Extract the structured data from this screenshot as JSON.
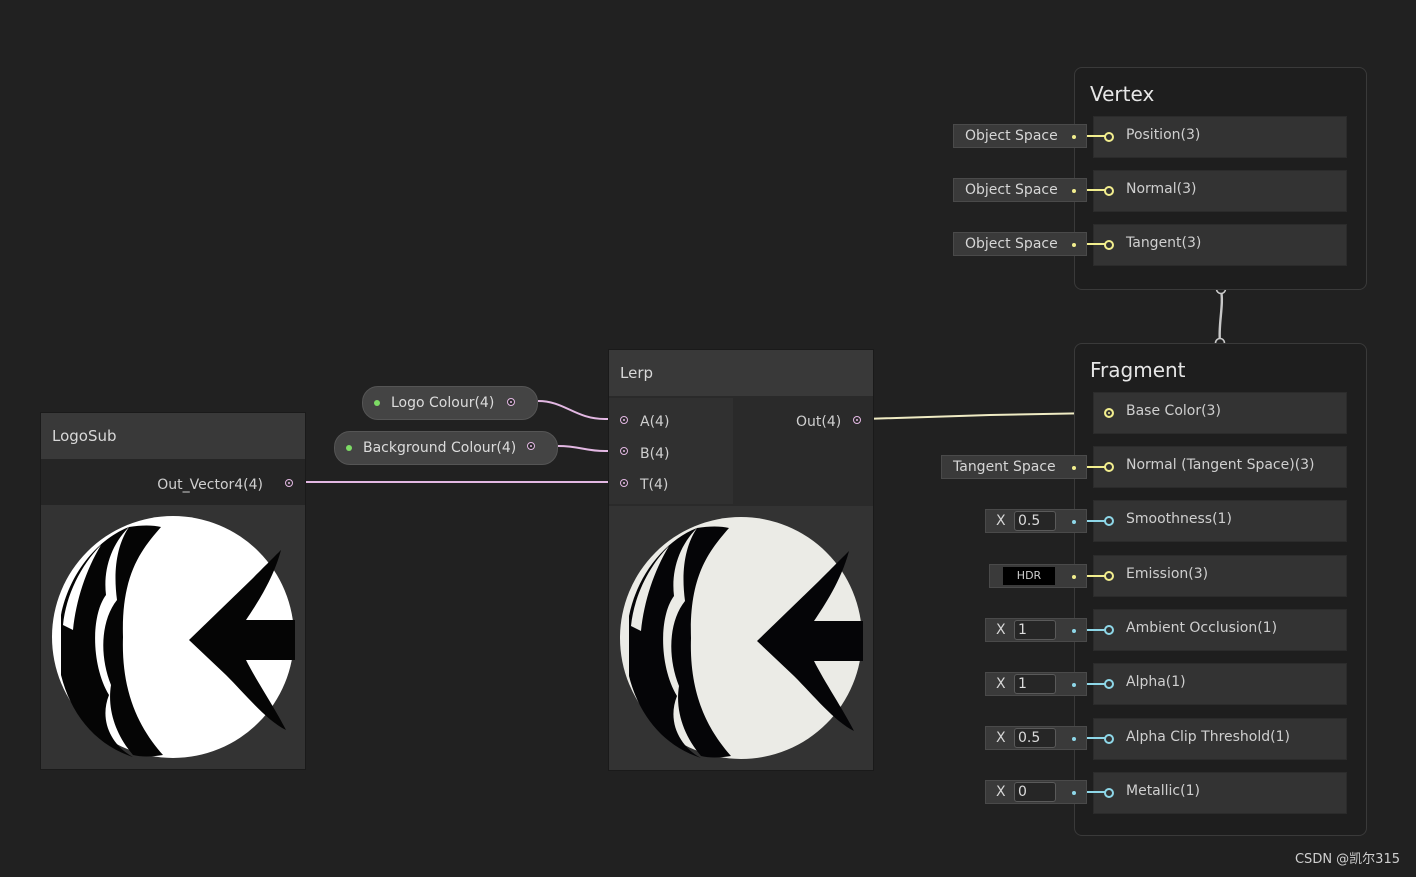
{
  "colors": {
    "background": "#212121",
    "float_port": "#e3b8e3",
    "vector3_port": "#f2ee8e",
    "vector1_port": "#8ed7e8",
    "property_dot": "#7ddc65"
  },
  "properties": [
    {
      "label": "Logo Colour(4)"
    },
    {
      "label": "Background Colour(4)"
    }
  ],
  "logosub": {
    "title": "LogoSub",
    "output": "Out_Vector4(4)"
  },
  "lerp": {
    "title": "Lerp",
    "inputs": [
      "A(4)",
      "B(4)",
      "T(4)"
    ],
    "output": "Out(4)"
  },
  "vertex": {
    "title": "Vertex",
    "blocks": [
      {
        "label": "Position(3)",
        "widget": "Object Space"
      },
      {
        "label": "Normal(3)",
        "widget": "Object Space"
      },
      {
        "label": "Tangent(3)",
        "widget": "Object Space"
      }
    ]
  },
  "fragment": {
    "title": "Fragment",
    "blocks": [
      {
        "label": "Base Color(3)"
      },
      {
        "label": "Normal (Tangent Space)(3)",
        "widget": "Tangent Space"
      },
      {
        "label": "Smoothness(1)",
        "axis": "X",
        "value": "0.5"
      },
      {
        "label": "Emission(3)",
        "widget": "HDR"
      },
      {
        "label": "Ambient Occlusion(1)",
        "axis": "X",
        "value": "1"
      },
      {
        "label": "Alpha(1)",
        "axis": "X",
        "value": "1"
      },
      {
        "label": "Alpha Clip Threshold(1)",
        "axis": "X",
        "value": "0.5"
      },
      {
        "label": "Metallic(1)",
        "axis": "X",
        "value": "0"
      }
    ]
  },
  "watermark": "CSDN @凯尔315"
}
